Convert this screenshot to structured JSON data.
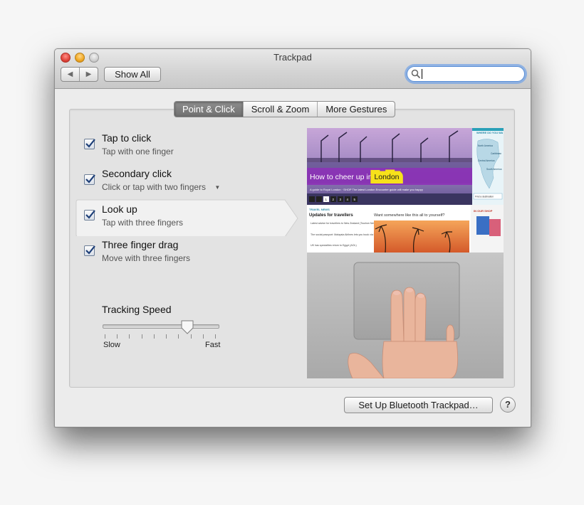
{
  "window": {
    "title": "Trackpad"
  },
  "toolbar": {
    "back": "◀",
    "forward": "▶",
    "show_all": "Show All",
    "search_value": ""
  },
  "tabs": [
    {
      "label": "Point & Click",
      "active": true
    },
    {
      "label": "Scroll & Zoom",
      "active": false
    },
    {
      "label": "More Gestures",
      "active": false
    }
  ],
  "options": [
    {
      "label": "Tap to click",
      "sub": "Tap with one finger",
      "checked": true
    },
    {
      "label": "Secondary click",
      "sub": "Click or tap with two fingers",
      "checked": true,
      "has_menu": true
    },
    {
      "label": "Look up",
      "sub": "Tap with three fingers",
      "checked": true,
      "selected": true
    },
    {
      "label": "Three finger drag",
      "sub": "Move with three fingers",
      "checked": true
    }
  ],
  "tracking": {
    "label": "Tracking Speed",
    "min_label": "Slow",
    "max_label": "Fast",
    "value_fraction": 0.75,
    "ticks": 10
  },
  "preview": {
    "headline_pre": "How to cheer up in ",
    "headline_hl": "London",
    "subline": "A guide to Royal London · SHOP The latest London Encounter guide will make you happy",
    "pager": [
      "1",
      "2",
      "3",
      "4",
      "5"
    ],
    "side_title": "WHERE DO YOU WA",
    "side_items": [
      "North America",
      "Caribbean",
      "Central America",
      "South America"
    ],
    "side_find": "Find a destination",
    "news_tag": "TRAVEL NEWS",
    "news_title": "Updates for travellers",
    "news_items": [
      "Latest advice for travellers to New Zealand (Tourism New Zealand)",
      "The social passport: Malaysia Airlines lets you book via Facebook (Travel.tv)",
      "UK has specialties return to Egypt (AOL)"
    ],
    "want_text": "Want somewhere like this all to yourself?",
    "shop_title": "IN OUR SHOP"
  },
  "footer": {
    "bluetooth": "Set Up Bluetooth Trackpad…",
    "help": "?"
  },
  "colors": {
    "accent_blue": "#3a6fc4",
    "headline_purple": "#7a3fb0",
    "highlight_yellow": "#f7e11a"
  }
}
